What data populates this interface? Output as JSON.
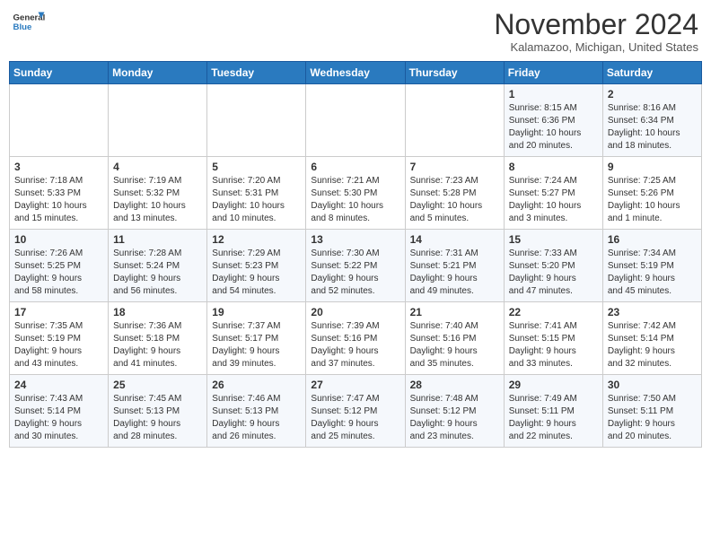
{
  "header": {
    "logo_line1": "General",
    "logo_line2": "Blue",
    "month_year": "November 2024",
    "location": "Kalamazoo, Michigan, United States"
  },
  "days_of_week": [
    "Sunday",
    "Monday",
    "Tuesday",
    "Wednesday",
    "Thursday",
    "Friday",
    "Saturday"
  ],
  "weeks": [
    [
      {
        "day": "",
        "info": ""
      },
      {
        "day": "",
        "info": ""
      },
      {
        "day": "",
        "info": ""
      },
      {
        "day": "",
        "info": ""
      },
      {
        "day": "",
        "info": ""
      },
      {
        "day": "1",
        "info": "Sunrise: 8:15 AM\nSunset: 6:36 PM\nDaylight: 10 hours\nand 20 minutes."
      },
      {
        "day": "2",
        "info": "Sunrise: 8:16 AM\nSunset: 6:34 PM\nDaylight: 10 hours\nand 18 minutes."
      }
    ],
    [
      {
        "day": "3",
        "info": "Sunrise: 7:18 AM\nSunset: 5:33 PM\nDaylight: 10 hours\nand 15 minutes."
      },
      {
        "day": "4",
        "info": "Sunrise: 7:19 AM\nSunset: 5:32 PM\nDaylight: 10 hours\nand 13 minutes."
      },
      {
        "day": "5",
        "info": "Sunrise: 7:20 AM\nSunset: 5:31 PM\nDaylight: 10 hours\nand 10 minutes."
      },
      {
        "day": "6",
        "info": "Sunrise: 7:21 AM\nSunset: 5:30 PM\nDaylight: 10 hours\nand 8 minutes."
      },
      {
        "day": "7",
        "info": "Sunrise: 7:23 AM\nSunset: 5:28 PM\nDaylight: 10 hours\nand 5 minutes."
      },
      {
        "day": "8",
        "info": "Sunrise: 7:24 AM\nSunset: 5:27 PM\nDaylight: 10 hours\nand 3 minutes."
      },
      {
        "day": "9",
        "info": "Sunrise: 7:25 AM\nSunset: 5:26 PM\nDaylight: 10 hours\nand 1 minute."
      }
    ],
    [
      {
        "day": "10",
        "info": "Sunrise: 7:26 AM\nSunset: 5:25 PM\nDaylight: 9 hours\nand 58 minutes."
      },
      {
        "day": "11",
        "info": "Sunrise: 7:28 AM\nSunset: 5:24 PM\nDaylight: 9 hours\nand 56 minutes."
      },
      {
        "day": "12",
        "info": "Sunrise: 7:29 AM\nSunset: 5:23 PM\nDaylight: 9 hours\nand 54 minutes."
      },
      {
        "day": "13",
        "info": "Sunrise: 7:30 AM\nSunset: 5:22 PM\nDaylight: 9 hours\nand 52 minutes."
      },
      {
        "day": "14",
        "info": "Sunrise: 7:31 AM\nSunset: 5:21 PM\nDaylight: 9 hours\nand 49 minutes."
      },
      {
        "day": "15",
        "info": "Sunrise: 7:33 AM\nSunset: 5:20 PM\nDaylight: 9 hours\nand 47 minutes."
      },
      {
        "day": "16",
        "info": "Sunrise: 7:34 AM\nSunset: 5:19 PM\nDaylight: 9 hours\nand 45 minutes."
      }
    ],
    [
      {
        "day": "17",
        "info": "Sunrise: 7:35 AM\nSunset: 5:19 PM\nDaylight: 9 hours\nand 43 minutes."
      },
      {
        "day": "18",
        "info": "Sunrise: 7:36 AM\nSunset: 5:18 PM\nDaylight: 9 hours\nand 41 minutes."
      },
      {
        "day": "19",
        "info": "Sunrise: 7:37 AM\nSunset: 5:17 PM\nDaylight: 9 hours\nand 39 minutes."
      },
      {
        "day": "20",
        "info": "Sunrise: 7:39 AM\nSunset: 5:16 PM\nDaylight: 9 hours\nand 37 minutes."
      },
      {
        "day": "21",
        "info": "Sunrise: 7:40 AM\nSunset: 5:16 PM\nDaylight: 9 hours\nand 35 minutes."
      },
      {
        "day": "22",
        "info": "Sunrise: 7:41 AM\nSunset: 5:15 PM\nDaylight: 9 hours\nand 33 minutes."
      },
      {
        "day": "23",
        "info": "Sunrise: 7:42 AM\nSunset: 5:14 PM\nDaylight: 9 hours\nand 32 minutes."
      }
    ],
    [
      {
        "day": "24",
        "info": "Sunrise: 7:43 AM\nSunset: 5:14 PM\nDaylight: 9 hours\nand 30 minutes."
      },
      {
        "day": "25",
        "info": "Sunrise: 7:45 AM\nSunset: 5:13 PM\nDaylight: 9 hours\nand 28 minutes."
      },
      {
        "day": "26",
        "info": "Sunrise: 7:46 AM\nSunset: 5:13 PM\nDaylight: 9 hours\nand 26 minutes."
      },
      {
        "day": "27",
        "info": "Sunrise: 7:47 AM\nSunset: 5:12 PM\nDaylight: 9 hours\nand 25 minutes."
      },
      {
        "day": "28",
        "info": "Sunrise: 7:48 AM\nSunset: 5:12 PM\nDaylight: 9 hours\nand 23 minutes."
      },
      {
        "day": "29",
        "info": "Sunrise: 7:49 AM\nSunset: 5:11 PM\nDaylight: 9 hours\nand 22 minutes."
      },
      {
        "day": "30",
        "info": "Sunrise: 7:50 AM\nSunset: 5:11 PM\nDaylight: 9 hours\nand 20 minutes."
      }
    ]
  ]
}
